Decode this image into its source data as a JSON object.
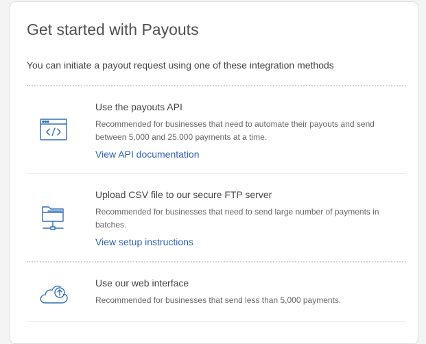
{
  "page": {
    "title": "Get started with Payouts",
    "intro": "You can initiate a payout request using one of these integration methods"
  },
  "methods": [
    {
      "icon": "code-window-icon",
      "title": "Use the payouts API",
      "description": "Recommended for businesses that need to automate their payouts and send between 5,000 and 25,000 payments at a time.",
      "link": "View API documentation"
    },
    {
      "icon": "ftp-folder-icon",
      "title": "Upload CSV file to our secure FTP server",
      "description": "Recommended for businesses that need to send large number of payments in batches.",
      "link": "View setup instructions"
    },
    {
      "icon": "cloud-upload-icon",
      "title": "Use our web interface",
      "description": "Recommended for businesses that send less than 5,000 payments."
    }
  ],
  "colors": {
    "accent": "#2e5fb6",
    "icon": "#2f6fb5",
    "text": "#444444",
    "muted": "#666666"
  }
}
